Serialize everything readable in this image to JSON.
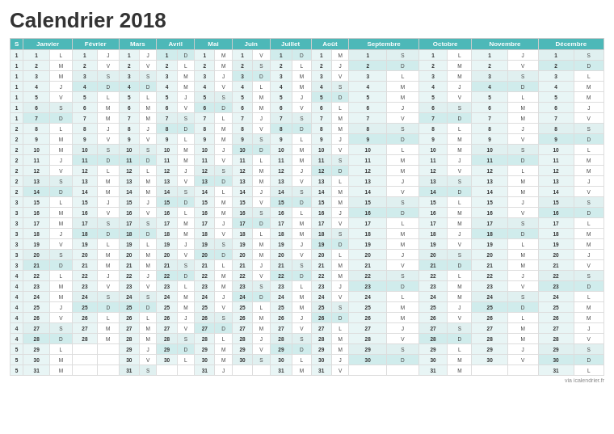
{
  "title": "Calendrier 2018",
  "footer": "via icalendrier.fr",
  "months": [
    "Janvier",
    "Février",
    "Mars",
    "Avril",
    "Mai",
    "Juin",
    "Juillet",
    "Août",
    "Septembre",
    "Octobre",
    "Novembre",
    "Décembre"
  ],
  "accent_color": "#4db8b8"
}
